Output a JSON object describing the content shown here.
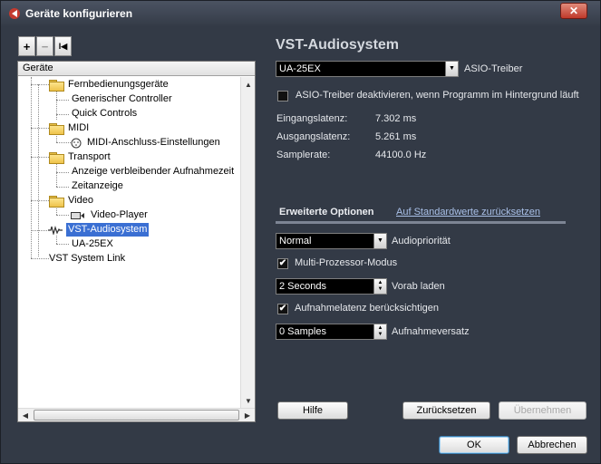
{
  "window": {
    "title": "Geräte konfigurieren",
    "close_glyph": "✕"
  },
  "toolbar": {
    "add": "+",
    "remove": "−",
    "reset": "I◀"
  },
  "tree": {
    "header": "Geräte",
    "items": [
      {
        "label": "Fernbedienungsgeräte",
        "icon": "folder-icon"
      },
      {
        "label": "Generischer Controller"
      },
      {
        "label": "Quick Controls"
      },
      {
        "label": "MIDI",
        "icon": "folder-icon"
      },
      {
        "label": "MIDI-Anschluss-Einstellungen",
        "icon": "midi-port-icon"
      },
      {
        "label": "Transport",
        "icon": "folder-icon"
      },
      {
        "label": "Anzeige verbleibender Aufnahmezeit"
      },
      {
        "label": "Zeitanzeige"
      },
      {
        "label": "Video",
        "icon": "folder-icon"
      },
      {
        "label": "Video-Player",
        "icon": "video-icon"
      },
      {
        "label": "VST-Audiosystem",
        "icon": "audio-wave-icon",
        "selected": true
      },
      {
        "label": "UA-25EX"
      },
      {
        "label": "VST System Link"
      }
    ]
  },
  "panel": {
    "title": "VST-Audiosystem",
    "driver": {
      "value": "UA-25EX",
      "label": "ASIO-Treiber"
    },
    "deactivate_checkbox": {
      "label": "ASIO-Treiber deaktivieren, wenn Programm im Hintergrund läuft",
      "checked": false
    },
    "info": [
      {
        "label": "Eingangslatenz:",
        "value": "7.302 ms"
      },
      {
        "label": "Ausgangslatenz:",
        "value": "5.261 ms"
      },
      {
        "label": "Samplerate:",
        "value": "44100.0 Hz"
      }
    ],
    "tab": "Erweiterte Optionen",
    "reset_link": "Auf Standardwerte zurücksetzen",
    "priority": {
      "value": "Normal",
      "label": "Audiopriorität"
    },
    "multiprocessor": {
      "label": "Multi-Prozessor-Modus",
      "checked": true
    },
    "preload": {
      "value": "2 Seconds",
      "label": "Vorab laden"
    },
    "latency_check": {
      "label": "Aufnahmelatenz berücksichtigen",
      "checked": true
    },
    "offset": {
      "value": "0 Samples",
      "label": "Aufnahmeversatz"
    },
    "buttons": {
      "help": "Hilfe",
      "reset": "Zurücksetzen",
      "apply": "Übernehmen"
    }
  },
  "footer": {
    "ok": "OK",
    "cancel": "Abbrechen"
  },
  "colors": {
    "background": "#333a46",
    "selection": "#3a6fd3",
    "title_text": "#d4d8de",
    "link": "#a9c0e8"
  }
}
